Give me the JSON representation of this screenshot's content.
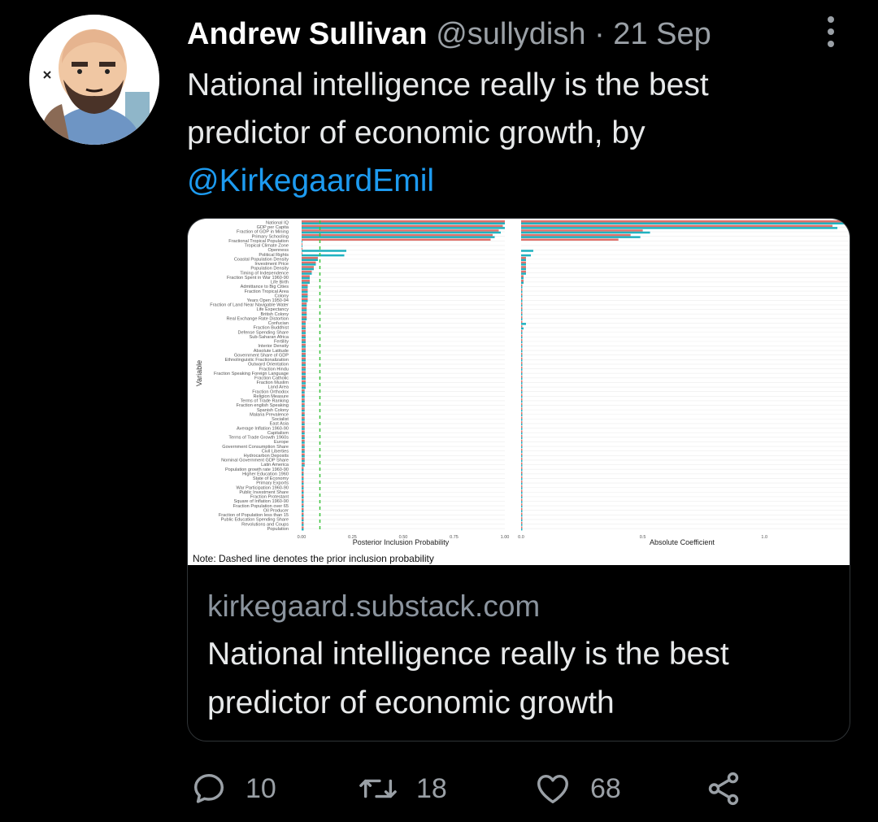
{
  "tweet": {
    "author_name": "Andrew Sullivan",
    "handle": "@sullydish",
    "separator": "·",
    "date": "21 Sep",
    "text": "National intelligence really is the best predictor of economic growth, by",
    "mention": "@KirkegaardEmil"
  },
  "card": {
    "domain": "kirkegaard.substack.com",
    "title": "National intelligence really is the best predictor of economic growth",
    "image": {
      "y_axis_label": "Variable",
      "left_x_label": "Posterior Inclusion Probability",
      "right_x_label": "Absolute Coefficient",
      "left_ticks": [
        "0.00",
        "0.25",
        "0.50",
        "0.75",
        "1.00"
      ],
      "right_ticks": [
        "0.0",
        "0.5",
        "1.0"
      ],
      "note": "Note: Dashed line denotes the prior inclusion probability",
      "colors": {
        "teal": "#20b2c0",
        "red": "#e0706a",
        "dashed": "#3cc43c"
      }
    }
  },
  "chart_data": {
    "type": "bar",
    "orientation": "horizontal",
    "categories": [
      "National IQ",
      "GDP per Capita",
      "Fraction of GDP in Mining",
      "Primary Schooling",
      "Fractional Tropical Population",
      "Tropical Climate Zone",
      "Openness",
      "Political Rights",
      "Coastal Population Density",
      "Investment Price",
      "Population Density",
      "Timing of Independence",
      "Fraction Spent in War 1960-90",
      "Life Birth",
      "Admittance to Big Cities",
      "Fraction Tropical Area",
      "Colony",
      "Years Open 1950-94",
      "Fraction of Land Near Navigable Water",
      "Life Expectancy",
      "British Colony",
      "Real Exchange Rate Distortion",
      "Confucian",
      "Fraction Buddhist",
      "Defense Spending Share",
      "Sub-Saharan Africa",
      "Fertility",
      "Interior Density",
      "Absolute Latitude",
      "Government Share of GDP",
      "Ethnolinguistic Fractionalization",
      "Outward Orientation",
      "Fraction Hindu",
      "Fraction Speaking Foreign Language",
      "Fraction Catholic",
      "Fraction Muslim",
      "Land Area",
      "Fraction Orthodox",
      "Religion Measure",
      "Terms of Trade Ranking",
      "Fraction english Speaking",
      "Spanish Colony",
      "Malaria Prevalence",
      "Socialist",
      "East Asia",
      "Average Inflation 1960-90",
      "Capitalism",
      "Terms of Trade Growth 1960s",
      "Europe",
      "Government Consumption Share",
      "Civil Liberties",
      "Hydrocarbon Deposits",
      "Nominal Government GDP Share",
      "Latin America",
      "Population growth rate 1960-90",
      "Higher Education 1960",
      "State of Economy",
      "Primary Exports",
      "War Participation 1960-90",
      "Public Investment Share",
      "Fraction Protestant",
      "Square of Inflation 1960-90",
      "Fraction Population over 65",
      "Oil Producer",
      "Fraction of Population less than 15",
      "Public Education Spending Share",
      "Revolutions and Coups",
      "Population"
    ],
    "series": [],
    "left_panel": {
      "xlabel": "Posterior Inclusion Probability",
      "ylabel": "Variable",
      "xlim": [
        0,
        1
      ],
      "teal": [
        1.0,
        1.0,
        0.98,
        0.95,
        0.0,
        0.0,
        0.22,
        0.21,
        0.08,
        0.07,
        0.06,
        0.05,
        0.04,
        0.04,
        0.03,
        0.03,
        0.03,
        0.03,
        0.025,
        0.025,
        0.025,
        0.025,
        0.02,
        0.02,
        0.02,
        0.02,
        0.02,
        0.02,
        0.02,
        0.02,
        0.02,
        0.02,
        0.02,
        0.02,
        0.02,
        0.02,
        0.02,
        0.015,
        0.015,
        0.015,
        0.015,
        0.015,
        0.015,
        0.015,
        0.015,
        0.015,
        0.015,
        0.015,
        0.015,
        0.015,
        0.015,
        0.015,
        0.015,
        0.015,
        0.01,
        0.01,
        0.01,
        0.01,
        0.01,
        0.01,
        0.01,
        0.01,
        0.01,
        0.01,
        0.01,
        0.01,
        0.01,
        0.01
      ],
      "red": [
        1.0,
        0.99,
        0.97,
        0.94,
        0.93,
        0.0,
        0.0,
        0.0,
        0.08,
        0.07,
        0.06,
        0.05,
        0.04,
        0.04,
        0.03,
        0.03,
        0.03,
        0.03,
        0.025,
        0.025,
        0.025,
        0.025,
        0.02,
        0.02,
        0.02,
        0.02,
        0.02,
        0.02,
        0.02,
        0.02,
        0.02,
        0.02,
        0.02,
        0.02,
        0.02,
        0.02,
        0.02,
        0.015,
        0.015,
        0.015,
        0.015,
        0.015,
        0.015,
        0.015,
        0.015,
        0.015,
        0.015,
        0.015,
        0.015,
        0.015,
        0.015,
        0.015,
        0.015,
        0.015,
        0.01,
        0.01,
        0.01,
        0.01,
        0.01,
        0.01,
        0.01,
        0.01,
        0.01,
        0.01,
        0.01,
        0.01,
        0.01,
        0.01
      ],
      "prior_line": 0.09
    },
    "right_panel": {
      "xlabel": "Absolute Coefficient",
      "xlim": [
        0,
        1.35
      ],
      "teal": [
        1.35,
        1.3,
        0.53,
        0.49,
        0.0,
        0.0,
        0.05,
        0.04,
        0.02,
        0.02,
        0.02,
        0.02,
        0.01,
        0.01,
        0.005,
        0.005,
        0.005,
        0.005,
        0.005,
        0.005,
        0.005,
        0.005,
        0.02,
        0.01,
        0.005,
        0.005,
        0.005,
        0.005,
        0.005,
        0.005,
        0.005,
        0.005,
        0.005,
        0.005,
        0.005,
        0.005,
        0.005,
        0.005,
        0.005,
        0.005,
        0.005,
        0.005,
        0.005,
        0.005,
        0.005,
        0.005,
        0.005,
        0.005,
        0.005,
        0.005,
        0.005,
        0.005,
        0.005,
        0.005,
        0.005,
        0.005,
        0.005,
        0.005,
        0.005,
        0.005,
        0.005,
        0.005,
        0.005,
        0.005,
        0.005,
        0.005,
        0.005,
        0.005
      ],
      "red": [
        1.35,
        1.28,
        0.5,
        0.45,
        0.4,
        0.0,
        0.0,
        0.0,
        0.02,
        0.02,
        0.02,
        0.02,
        0.01,
        0.01,
        0.005,
        0.005,
        0.005,
        0.005,
        0.005,
        0.005,
        0.005,
        0.005,
        0.005,
        0.005,
        0.005,
        0.005,
        0.005,
        0.005,
        0.005,
        0.005,
        0.005,
        0.005,
        0.005,
        0.005,
        0.005,
        0.005,
        0.005,
        0.005,
        0.005,
        0.005,
        0.005,
        0.005,
        0.005,
        0.005,
        0.005,
        0.005,
        0.005,
        0.005,
        0.005,
        0.005,
        0.005,
        0.005,
        0.005,
        0.005,
        0.005,
        0.005,
        0.005,
        0.005,
        0.005,
        0.005,
        0.005,
        0.005,
        0.005,
        0.005,
        0.005,
        0.005,
        0.005,
        0.005
      ]
    }
  },
  "actions": {
    "reply_count": "10",
    "retweet_count": "18",
    "like_count": "68"
  },
  "icons": {
    "reply": "reply-icon",
    "retweet": "retweet-icon",
    "like": "heart-icon",
    "share": "share-icon",
    "more": "more-vertical-icon"
  }
}
